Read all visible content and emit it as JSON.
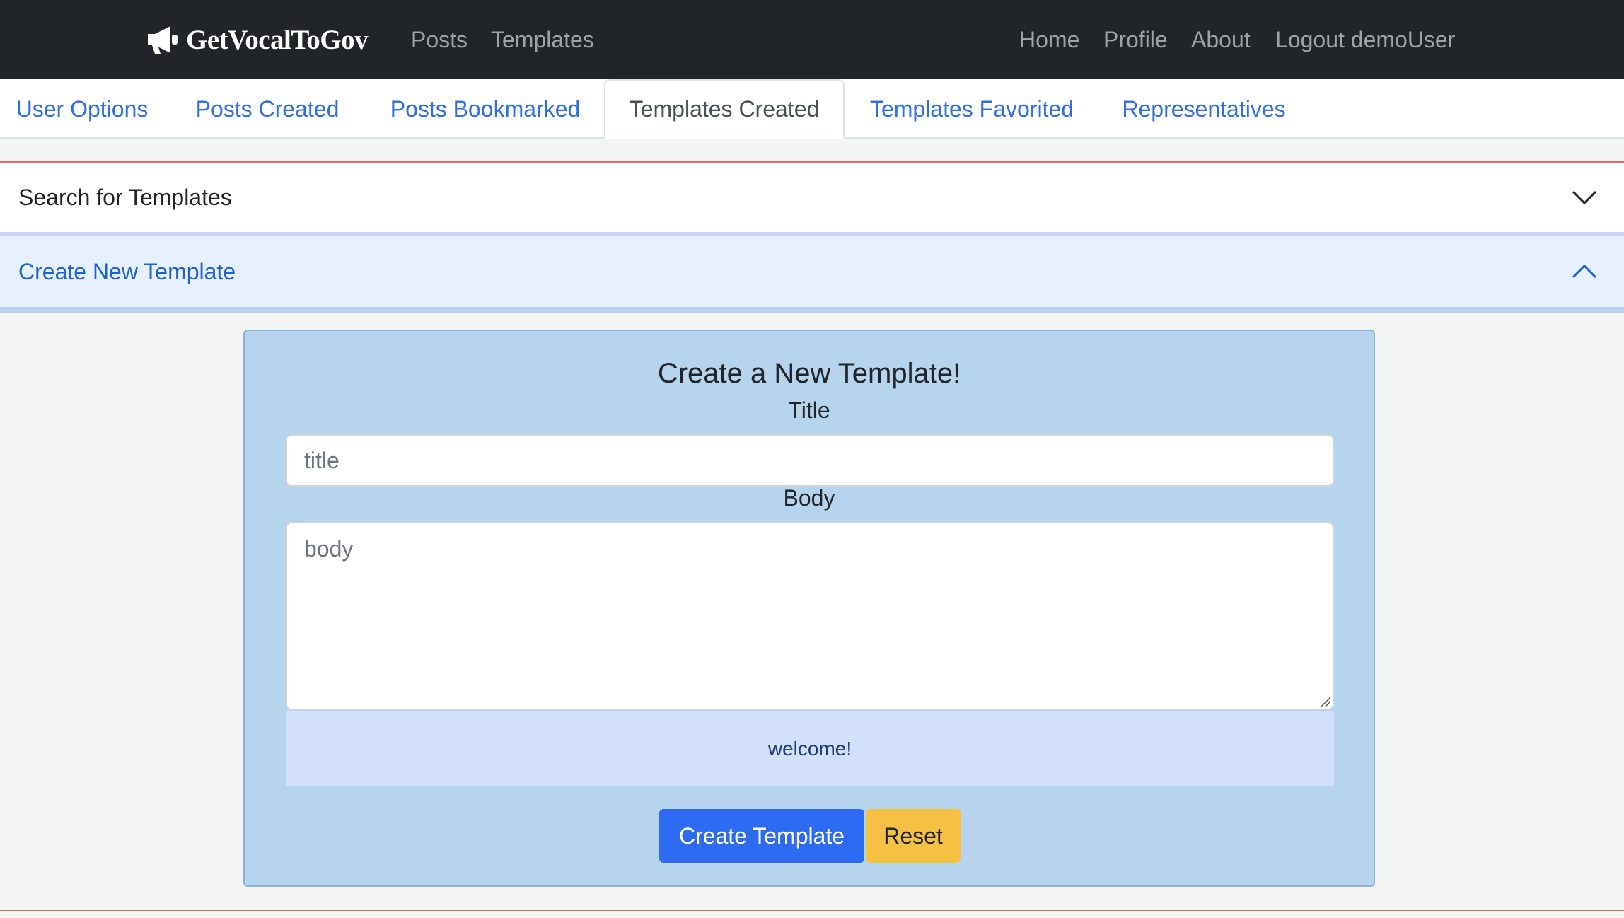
{
  "navbar": {
    "brand": "GetVocalToGov",
    "links_left": [
      "Posts",
      "Templates"
    ],
    "links_right": [
      "Home",
      "Profile",
      "About",
      "Logout demoUser"
    ],
    "brand_icon": "megaphone-icon"
  },
  "tabs": [
    {
      "label": "User Options",
      "active": false
    },
    {
      "label": "Posts Created",
      "active": false
    },
    {
      "label": "Posts Bookmarked",
      "active": false
    },
    {
      "label": "Templates Created",
      "active": true
    },
    {
      "label": "Templates Favorited",
      "active": false
    },
    {
      "label": "Representatives",
      "active": false
    }
  ],
  "accordion": {
    "search_header": "Search for Templates",
    "create_header": "Create New Template"
  },
  "form": {
    "heading": "Create a New Template!",
    "title_label": "Title",
    "title_placeholder": "title",
    "body_label": "Body",
    "body_placeholder": "body",
    "alert": "welcome!",
    "create_button": "Create Template",
    "reset_button": "Reset"
  },
  "colors": {
    "navbar": "#212529",
    "link": "#2f6fe0",
    "card": "#b6d4ee",
    "primary": "#2d6cf2",
    "warning": "#f6c143"
  }
}
